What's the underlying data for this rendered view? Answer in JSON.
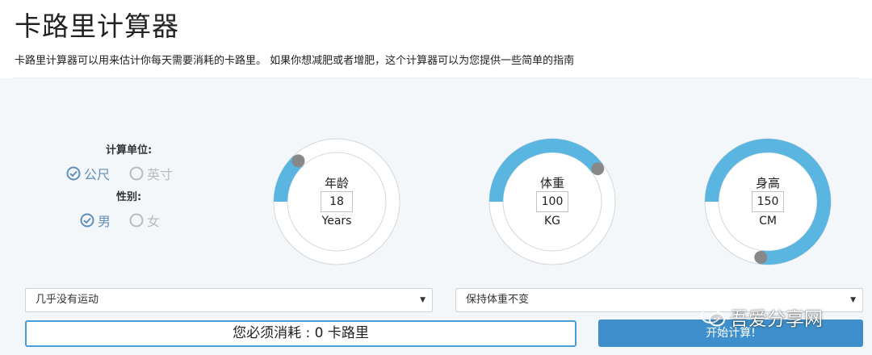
{
  "app": {
    "title": "卡路里计算器",
    "description": "卡路里计算器可以用来估计你每天需要消耗的卡路里。 如果你想减肥或者增肥，这个计算器可以为您提供一些简单的指南"
  },
  "units": {
    "label": "计算单位:",
    "options": [
      {
        "label": "公尺",
        "selected": true
      },
      {
        "label": "英寸",
        "selected": false
      }
    ]
  },
  "gender": {
    "label": "性别:",
    "options": [
      {
        "label": "男",
        "selected": true
      },
      {
        "label": "女",
        "selected": false
      }
    ]
  },
  "dials": {
    "age": {
      "label": "年龄",
      "value": "18",
      "unit": "Years",
      "fill": 0.13
    },
    "weight": {
      "label": "体重",
      "value": "100",
      "unit": "KG",
      "fill": 0.4
    },
    "height": {
      "label": "身高",
      "value": "150",
      "unit": "CM",
      "fill": 0.77
    }
  },
  "activity_select": {
    "value": "几乎没有运动"
  },
  "goal_select": {
    "value": "保持体重不变"
  },
  "result": {
    "text": "您必须消耗 : 0 卡路里"
  },
  "calculate_button": {
    "label": "开始计算!"
  },
  "watermark": {
    "text": "吾爱分享网"
  },
  "colors": {
    "accent": "#5ab6e0",
    "track": "#ffffff",
    "knob": "#888888",
    "check": "#5f8fbb",
    "button": "#3e8fcb"
  }
}
